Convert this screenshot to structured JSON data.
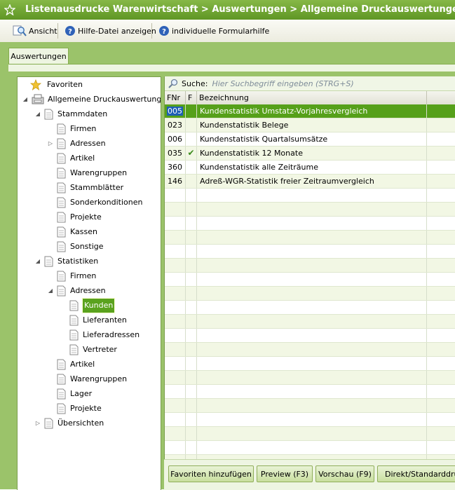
{
  "title": "Listenausdrucke Warenwirtschaft > Auswertungen > Allgemeine Druckauswertungen > Statis",
  "toolbar": {
    "ansicht": "Ansicht",
    "hilfe": "Hilfe-Datei anzeigen",
    "formularhilfe": "individuelle Formularhilfe"
  },
  "tab": "Auswertungen",
  "tree": {
    "favoriten": "Favoriten",
    "allgemein": "Allgemeine Druckauswertungen",
    "stammdaten": "Stammdaten",
    "s_firmen": "Firmen",
    "s_adressen": "Adressen",
    "s_artikel": "Artikel",
    "s_warengruppen": "Warengruppen",
    "s_stammblaetter": "Stammblätter",
    "s_sonderkonditionen": "Sonderkonditionen",
    "s_projekte": "Projekte",
    "s_kassen": "Kassen",
    "s_sonstige": "Sonstige",
    "statistiken": "Statistiken",
    "t_firmen": "Firmen",
    "t_adressen": "Adressen",
    "a_kunden": "Kunden",
    "a_lieferanten": "Lieferanten",
    "a_lieferadressen": "Lieferadressen",
    "a_vertreter": "Vertreter",
    "t_artikel": "Artikel",
    "t_warengruppen": "Warengruppen",
    "t_lager": "Lager",
    "t_projekte": "Projekte",
    "uebersichten": "Übersichten"
  },
  "search": {
    "label": "Suche:",
    "placeholder": "Hier Suchbegriff eingeben (STRG+S)"
  },
  "grid": {
    "headers": {
      "fnr": "FNr",
      "f": "F",
      "bezeichnung": "Bezeichnung"
    },
    "rows": [
      {
        "fnr": "005",
        "f": "",
        "bez": "Kundenstatistik Umstatz-Vorjahresvergleich"
      },
      {
        "fnr": "023",
        "f": "",
        "bez": "Kundenstatistik Belege"
      },
      {
        "fnr": "006",
        "f": "",
        "bez": "Kundenstatistik Quartalsumsätze"
      },
      {
        "fnr": "035",
        "f": "✔",
        "bez": "Kundenstatistik 12 Monate"
      },
      {
        "fnr": "360",
        "f": "",
        "bez": "Kundenstatistik alle Zeiträume"
      },
      {
        "fnr": "146",
        "f": "",
        "bez": "Adreß-WGR-Statistik freier Zeitraumvergleich"
      }
    ]
  },
  "buttons": {
    "favoriten": "Favoriten hinzufügen",
    "preview": "Preview (F3)",
    "vorschau": "Vorschau (F9)",
    "direkt": "Direkt/Standarddruc"
  },
  "colors": {
    "title_green": "#6fa332",
    "band_green": "#9bc36a",
    "selection": "#56a01a"
  }
}
